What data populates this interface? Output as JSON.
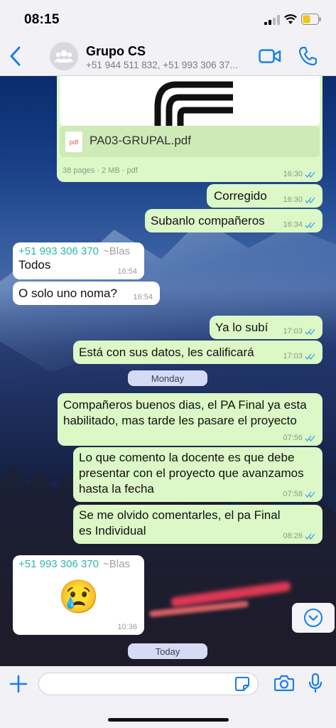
{
  "status": {
    "time": "08:15"
  },
  "header": {
    "title": "Grupo CS",
    "subtitle": "+51 944 511 832, +51 993 306 37..."
  },
  "doc_message": {
    "filename": "PA03-GRUPAL.pdf",
    "file_icon": "pdf",
    "info": "38 pages · 2 MB · pdf",
    "time": "16:30"
  },
  "messages": [
    {
      "dir": "out",
      "text": "Corregido",
      "time": "16:30"
    },
    {
      "dir": "out",
      "text": "Subanlo compañeros",
      "time": "16:34"
    },
    {
      "dir": "in",
      "sender": "+51 993 306 370",
      "alias": "~Blas",
      "text": "Todos",
      "time": "16:54"
    },
    {
      "dir": "in",
      "text": "O solo uno noma?",
      "time": "16:54"
    },
    {
      "dir": "out",
      "text": "Ya lo subí",
      "time": "17:03"
    },
    {
      "dir": "out",
      "text": "Está con sus datos, les calificará",
      "time": "17:03"
    },
    {
      "dir": "out",
      "text": "Compañeros buenos dias, el PA Final ya esta habilitado, mas tarde les pasare el proyecto",
      "time": "07:56"
    },
    {
      "dir": "out",
      "text": "Lo que comento la docente es que debe presentar con el proyecto que avanzamos hasta la fecha",
      "time": "07:58"
    },
    {
      "dir": "out",
      "text": "Se me olvido comentarles, el pa Final es Individual",
      "time": "08:26"
    },
    {
      "dir": "in",
      "sender": "+51 993 306 370",
      "alias": "~Blas",
      "text": "😢",
      "time": "10:36"
    }
  ],
  "day_separators": [
    "Monday",
    "Today"
  ],
  "input": {
    "placeholder": ""
  },
  "icons": {
    "back": "chevron-left-icon",
    "video": "video-call-icon",
    "phone": "phone-icon",
    "plus": "plus-icon",
    "sticker": "sticker-icon",
    "camera": "camera-icon",
    "mic": "microphone-icon",
    "scroll": "chevron-down-icon"
  },
  "colors": {
    "accent": "#1a7ee6",
    "outgoing": "#dbf8c6",
    "incoming": "#ffffff",
    "sender": "#2fb3b0",
    "ticks": "#4fa6e8"
  }
}
